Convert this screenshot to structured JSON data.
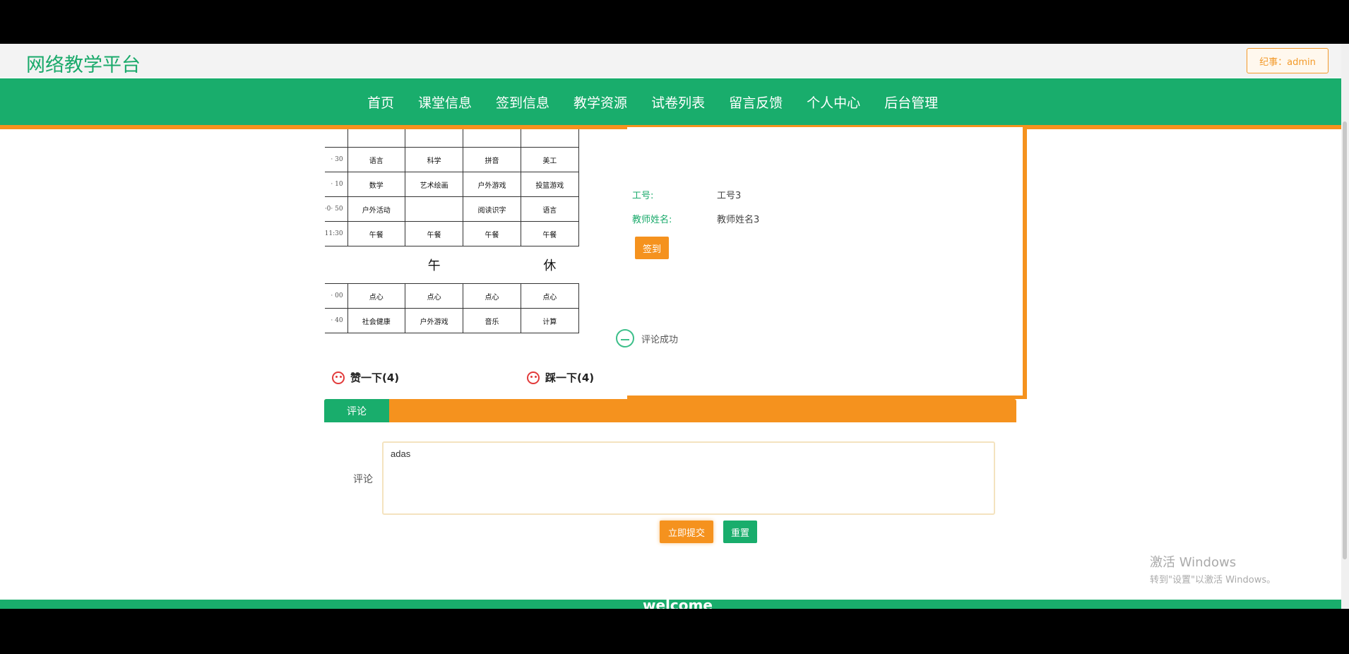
{
  "header": {
    "logo": "网络教学平台",
    "user_button": "纪事：admin"
  },
  "nav": {
    "items": [
      "首页",
      "课堂信息",
      "签到信息",
      "教学资源",
      "试卷列表",
      "留言反馈",
      "个人中心",
      "后台管理"
    ]
  },
  "schedule": {
    "rows": [
      {
        "time": "",
        "cells": [
          "",
          "",
          "",
          ""
        ]
      },
      {
        "time": "· 30",
        "cells": [
          "语言",
          "科学",
          "拼音",
          "美工"
        ]
      },
      {
        "time": "· 10",
        "cells": [
          "数学",
          "艺术绘画",
          "户外游戏",
          "投篮游戏"
        ]
      },
      {
        "time": "·0· 50",
        "cells": [
          "户外活动",
          "",
          "阅读识字",
          "语言"
        ]
      },
      {
        "time": "11:30",
        "cells": [
          "午餐",
          "午餐",
          "午餐",
          "午餐"
        ]
      }
    ],
    "break": [
      "午",
      "休"
    ],
    "rows_after": [
      {
        "time": "· 00",
        "cells": [
          "点心",
          "点心",
          "点心",
          "点心"
        ]
      },
      {
        "time": "· 40",
        "cells": [
          "社会健康",
          "户外游戏",
          "音乐",
          "计算"
        ]
      }
    ]
  },
  "likes": {
    "like_label": "赞一下(4)",
    "dislike_label": "踩一下(4)"
  },
  "info": {
    "id_label": "工号:",
    "id_value": "工号3",
    "name_label": "教师姓名:",
    "name_value": "教师姓名3",
    "sign_button": "签到"
  },
  "toast": {
    "message": "评论成功"
  },
  "comment": {
    "tab_label": "评论",
    "field_label": "评论",
    "value": "adas",
    "submit_label": "立即提交",
    "reset_label": "重置"
  },
  "watermark": {
    "line1": "激活 Windows",
    "line2": "转到\"设置\"以激活 Windows。"
  },
  "footer": {
    "text": "welcome"
  },
  "colors": {
    "green": "#19ad6c",
    "orange": "#f5921e"
  }
}
